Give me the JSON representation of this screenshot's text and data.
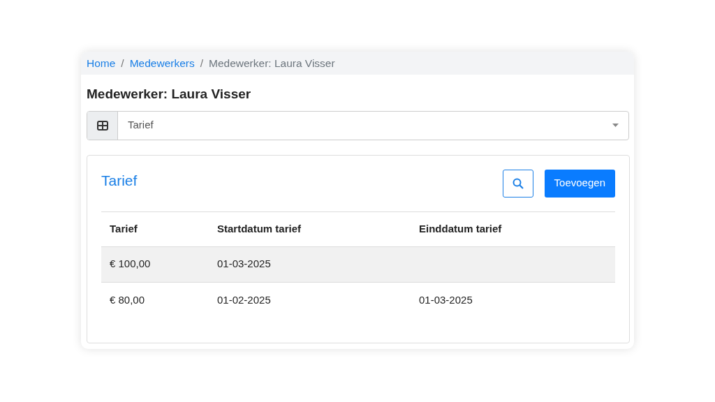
{
  "breadcrumb": [
    {
      "label": "Home",
      "link": true
    },
    {
      "label": "Medewerkers",
      "link": true
    },
    {
      "label": "Medewerker: Laura Visser",
      "link": false
    }
  ],
  "separator": "/",
  "page_title": "Medewerker: Laura Visser",
  "section_select": {
    "value": "Tarief"
  },
  "card": {
    "title": "Tarief",
    "add_button": "Toevoegen",
    "table": {
      "columns": [
        "Tarief",
        "Startdatum tarief",
        "Einddatum tarief"
      ],
      "rows": [
        {
          "highlighted": true,
          "cells": [
            "€ 100,00",
            "01-03-2025",
            null
          ]
        },
        {
          "highlighted": false,
          "cells": [
            "€ 80,00",
            "01-02-2025",
            "01-03-2025"
          ]
        }
      ]
    }
  }
}
